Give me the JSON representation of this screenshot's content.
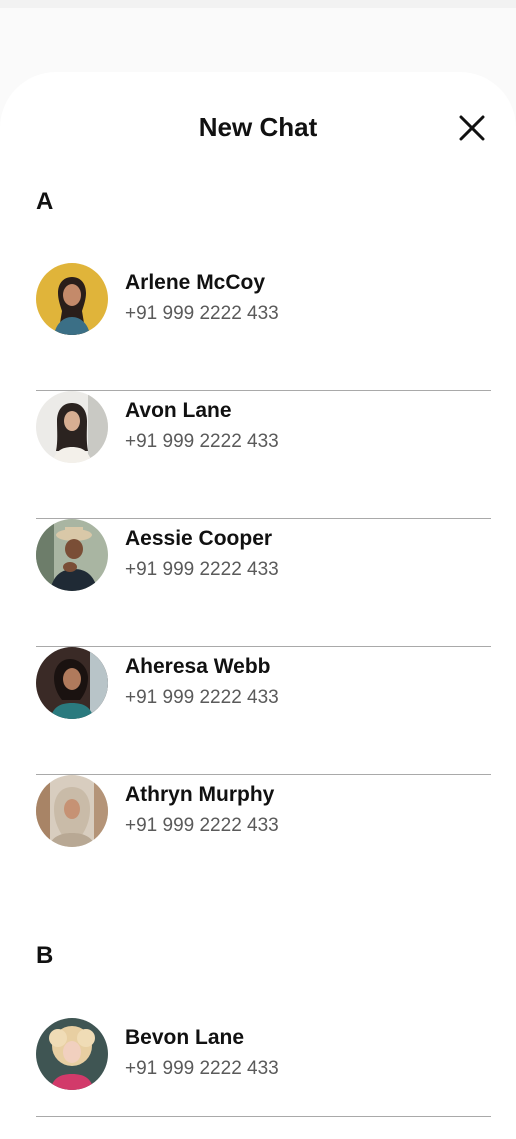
{
  "header": {
    "title": "New Chat",
    "close_icon": "close-icon"
  },
  "sections": [
    {
      "letter": "A",
      "contacts": [
        {
          "name": "Arlene McCoy",
          "phone": "+91 999 2222 433",
          "avatar_bg": "#e0b43a"
        },
        {
          "name": "Avon Lane",
          "phone": "+91 999 2222 433",
          "avatar_bg": "#e8e8e6"
        },
        {
          "name": "Aessie Cooper",
          "phone": "+91 999 2222 433",
          "avatar_bg": "#a9b5a2"
        },
        {
          "name": "Aheresa Webb",
          "phone": "+91 999 2222 433",
          "avatar_bg": "#3a2a26"
        },
        {
          "name": "Athryn Murphy",
          "phone": "+91 999 2222 433",
          "avatar_bg": "#d8cdbf"
        }
      ]
    },
    {
      "letter": "B",
      "contacts": [
        {
          "name": "Bevon Lane",
          "phone": "+91 999 2222 433",
          "avatar_bg": "#3f5553"
        }
      ]
    }
  ]
}
